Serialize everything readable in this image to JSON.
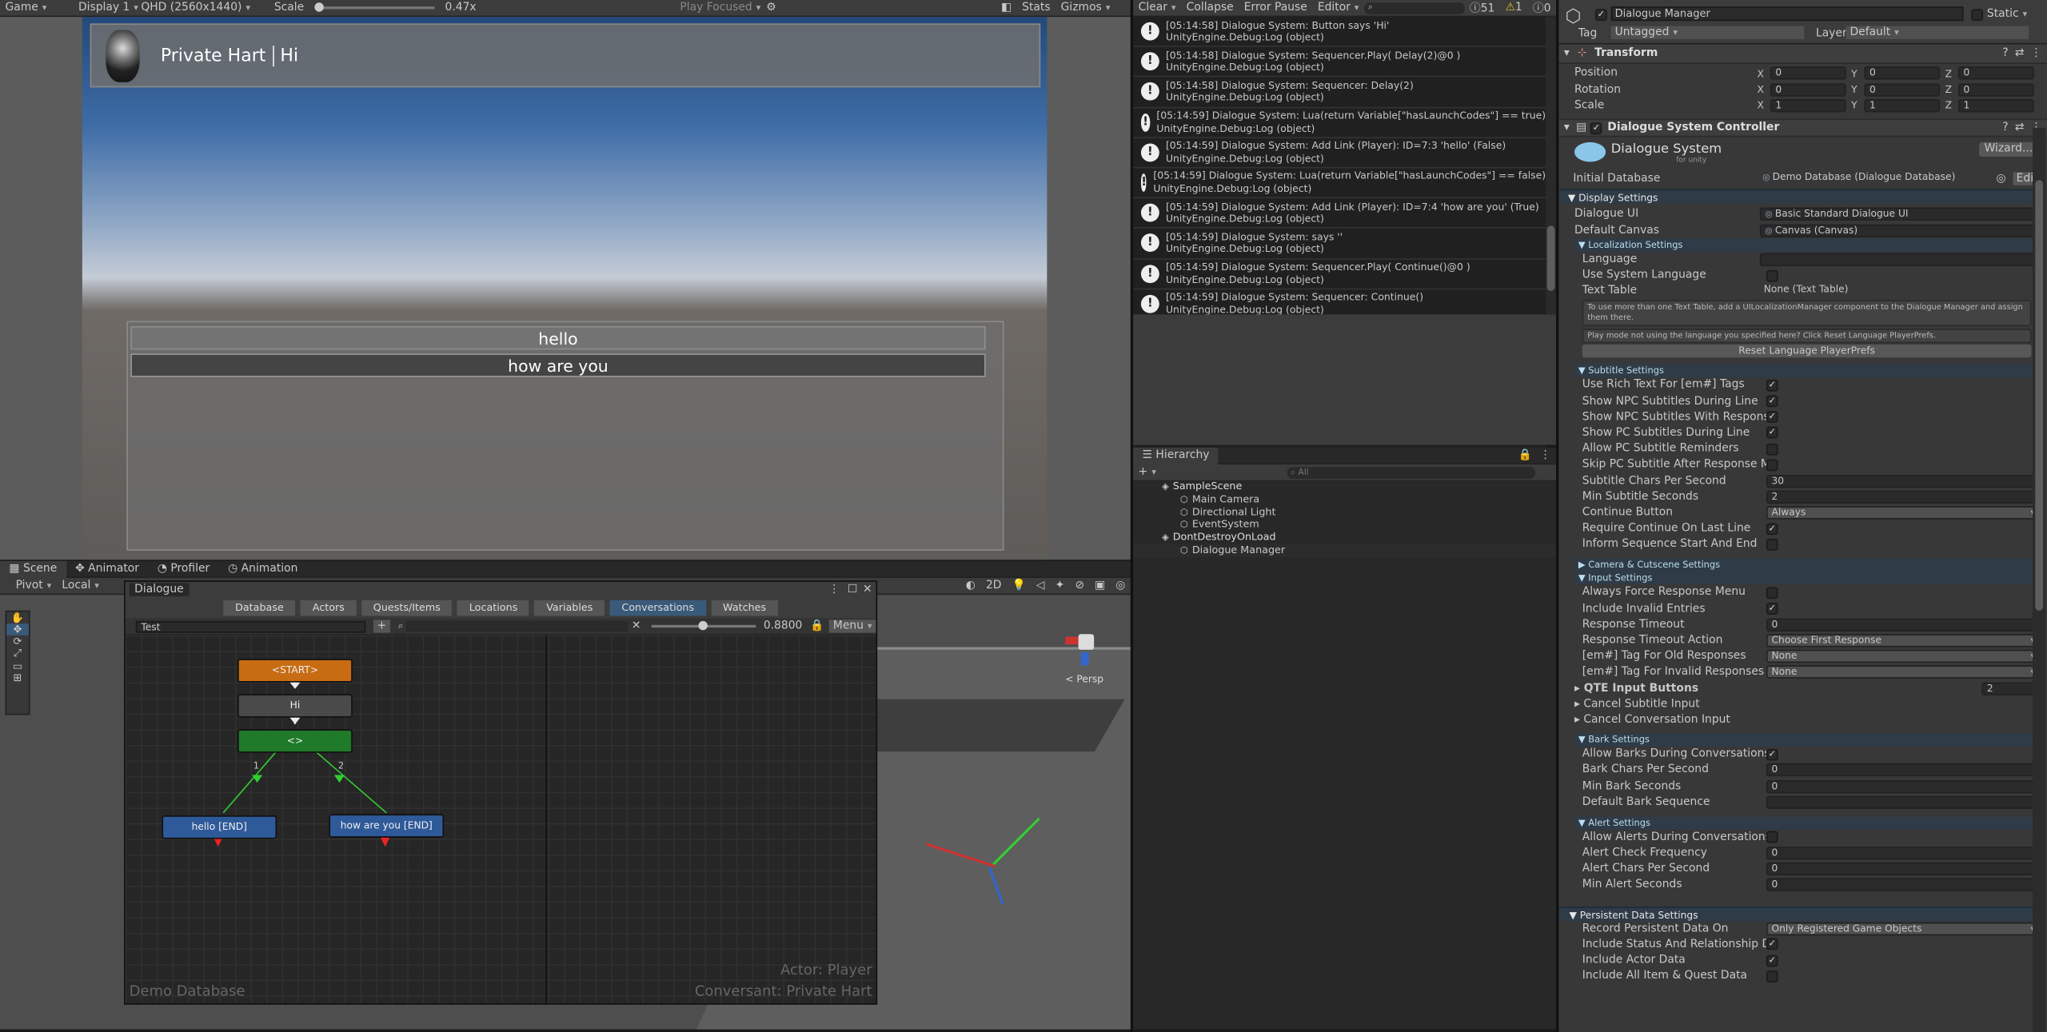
{
  "game": {
    "tab_label": "Game",
    "display": "Display 1",
    "resolution": "QHD (2560x1440)",
    "scale_label": "Scale",
    "scale_value": "0.47x",
    "play_mode": "Play Focused",
    "stats": "Stats",
    "gizmos": "Gizmos",
    "speaker_name": "Private Hart",
    "subtitle": "Hi",
    "responses": [
      "hello",
      "how are you"
    ]
  },
  "scene": {
    "tabs": [
      "Scene",
      "Animator",
      "Profiler",
      "Animation"
    ],
    "pivot": "Pivot",
    "local": "Local",
    "mode_2d": "2D",
    "persp": "< Persp"
  },
  "dialogue_editor": {
    "title": "Dialogue",
    "tabs": [
      "Database",
      "Actors",
      "Quests/Items",
      "Locations",
      "Variables",
      "Conversations",
      "Watches"
    ],
    "active_tab": "Conversations",
    "conversation": "Test",
    "zoom": "0.8800",
    "menu": "Menu",
    "nodes": {
      "start": "<START>",
      "hi": "Hi",
      "group": "<>",
      "hello": "hello [END]",
      "howareyou": "how are you [END]"
    },
    "link_labels": [
      "1",
      "2"
    ],
    "db_name": "Demo Database",
    "actor": "Actor: Player",
    "conversant": "Conversant: Private Hart"
  },
  "console": {
    "clear": "Clear",
    "collapse": "Collapse",
    "error_pause": "Error Pause",
    "editor": "Editor",
    "count_log": "51",
    "count_warn": "1",
    "count_err": "0",
    "entries": [
      [
        "[05:14:58] Dialogue System: Button says 'Hi'",
        "UnityEngine.Debug:Log (object)"
      ],
      [
        "[05:14:58] Dialogue System: Sequencer.Play( Delay(2)@0 )",
        "UnityEngine.Debug:Log (object)"
      ],
      [
        "[05:14:58] Dialogue System: Sequencer: Delay(2)",
        "UnityEngine.Debug:Log (object)"
      ],
      [
        "[05:14:59] Dialogue System: Lua(return Variable[\"hasLaunchCodes\"] == true)",
        "UnityEngine.Debug:Log (object)"
      ],
      [
        "[05:14:59] Dialogue System: Add Link (Player): ID=7:3 'hello' (False)",
        "UnityEngine.Debug:Log (object)"
      ],
      [
        "[05:14:59] Dialogue System: Lua(return Variable[\"hasLaunchCodes\"] == false)",
        "UnityEngine.Debug:Log (object)"
      ],
      [
        "[05:14:59] Dialogue System: Add Link (Player): ID=7:4 'how are you' (True)",
        "UnityEngine.Debug:Log (object)"
      ],
      [
        "[05:14:59] Dialogue System:  says ''",
        "UnityEngine.Debug:Log (object)"
      ],
      [
        "[05:14:59] Dialogue System: Sequencer.Play( Continue()@0 )",
        "UnityEngine.Debug:Log (object)"
      ],
      [
        "[05:14:59] Dialogue System: Sequencer: Continue()",
        "UnityEngine.Debug:Log (object)"
      ]
    ]
  },
  "hierarchy": {
    "title": "Hierarchy",
    "search_placeholder": "All",
    "items": [
      {
        "label": "SampleScene",
        "depth": 0
      },
      {
        "label": "Main Camera",
        "depth": 1
      },
      {
        "label": "Directional Light",
        "depth": 1
      },
      {
        "label": "EventSystem",
        "depth": 1
      },
      {
        "label": "DontDestroyOnLoad",
        "depth": 0
      },
      {
        "label": "Dialogue Manager",
        "depth": 1
      }
    ]
  },
  "inspector": {
    "object_name": "Dialogue Manager",
    "static": "Static",
    "tag_label": "Tag",
    "tag": "Untagged",
    "layer_label": "Layer",
    "layer": "Default",
    "transform": {
      "title": "Transform",
      "position": "Position",
      "rotation": "Rotation",
      "scale": "Scale",
      "pos": [
        "0",
        "0",
        "0"
      ],
      "rot": [
        "0",
        "0",
        "0"
      ],
      "scl": [
        "1",
        "1",
        "1"
      ]
    },
    "component": "Dialogue System Controller",
    "logo": "Dialogue System",
    "logo_sub": "for unity",
    "wizard": "Wizard...",
    "initial_db_label": "Initial Database",
    "initial_db": "Demo Database (Dialogue Database)",
    "edit": "Edit",
    "display_settings": "Display Settings",
    "dialogue_ui_label": "Dialogue UI",
    "dialogue_ui": "Basic Standard Dialogue UI",
    "default_canvas_label": "Default Canvas",
    "default_canvas": "Canvas (Canvas)",
    "localization": "Localization Settings",
    "language": "Language",
    "use_system_language": "Use System Language",
    "text_table": "Text Table",
    "text_table_val": "None (Text Table)",
    "loc_help": "To use more than one Text Table, add a UILocalizationManager component to the Dialogue Manager and assign them there.",
    "loc_help2": "Play mode not using the language you specified here? Click Reset Language PlayerPrefs.",
    "reset_btn": "Reset Language PlayerPrefs",
    "subtitle_settings": "Subtitle Settings",
    "subtitle_rows": [
      {
        "label": "Use Rich Text For [em#] Tags",
        "check": true
      },
      {
        "label": "Show NPC Subtitles During Line",
        "check": true
      },
      {
        "label": "Show NPC Subtitles With Responses",
        "check": true
      },
      {
        "label": "Show PC Subtitles During Line",
        "check": true
      },
      {
        "label": "Allow PC Subtitle Reminders",
        "check": false
      },
      {
        "label": "Skip PC Subtitle After Response Menu",
        "check": false
      },
      {
        "label": "Subtitle Chars Per Second",
        "value": "30"
      },
      {
        "label": "Min Subtitle Seconds",
        "value": "2"
      },
      {
        "label": "Continue Button",
        "value": "Always",
        "dropdown": true
      },
      {
        "label": "Require Continue On Last Line",
        "check": true
      },
      {
        "label": "Inform Sequence Start And End",
        "check": false
      }
    ],
    "camera_settings": "Camera & Cutscene Settings",
    "input_settings": "Input Settings",
    "input_rows": [
      {
        "label": "Always Force Response Menu",
        "check": false
      },
      {
        "label": "Include Invalid Entries",
        "check": true
      },
      {
        "label": "Response Timeout",
        "value": "0"
      },
      {
        "label": "Response Timeout Action",
        "value": "Choose First Response",
        "dropdown": true
      },
      {
        "label": "[em#] Tag For Old Responses",
        "value": "None",
        "dropdown": true
      },
      {
        "label": "[em#] Tag For Invalid Responses",
        "value": "None",
        "dropdown": true
      }
    ],
    "qte": "QTE Input Buttons",
    "qte_val": "2",
    "cancel_subtitle": "Cancel Subtitle Input",
    "cancel_conv": "Cancel Conversation Input",
    "bark_settings": "Bark Settings",
    "bark_rows": [
      {
        "label": "Allow Barks During Conversations",
        "check": true
      },
      {
        "label": "Bark Chars Per Second",
        "value": "0"
      },
      {
        "label": "Min Bark Seconds",
        "value": "0"
      },
      {
        "label": "Default Bark Sequence",
        "value": ""
      }
    ],
    "alert_settings": "Alert Settings",
    "alert_rows": [
      {
        "label": "Allow Alerts During Conversations",
        "check": false
      },
      {
        "label": "Alert Check Frequency",
        "value": "0"
      },
      {
        "label": "Alert Chars Per Second",
        "value": "0"
      },
      {
        "label": "Min Alert Seconds",
        "value": "0"
      }
    ],
    "persistent": "Persistent Data Settings",
    "persist_rows": [
      {
        "label": "Record Persistent Data On",
        "value": "Only Registered Game Objects",
        "dropdown": true
      },
      {
        "label": "Include Status And Relationship Data",
        "check": true
      },
      {
        "label": "Include Actor Data",
        "check": true
      },
      {
        "label": "Include All Item & Quest Data",
        "check": false
      }
    ]
  },
  "colors": {
    "accent": "#3a5a7a",
    "start_node": "#c86c14",
    "group_node": "#1f7a2a",
    "end_node": "#2f5a9a"
  }
}
